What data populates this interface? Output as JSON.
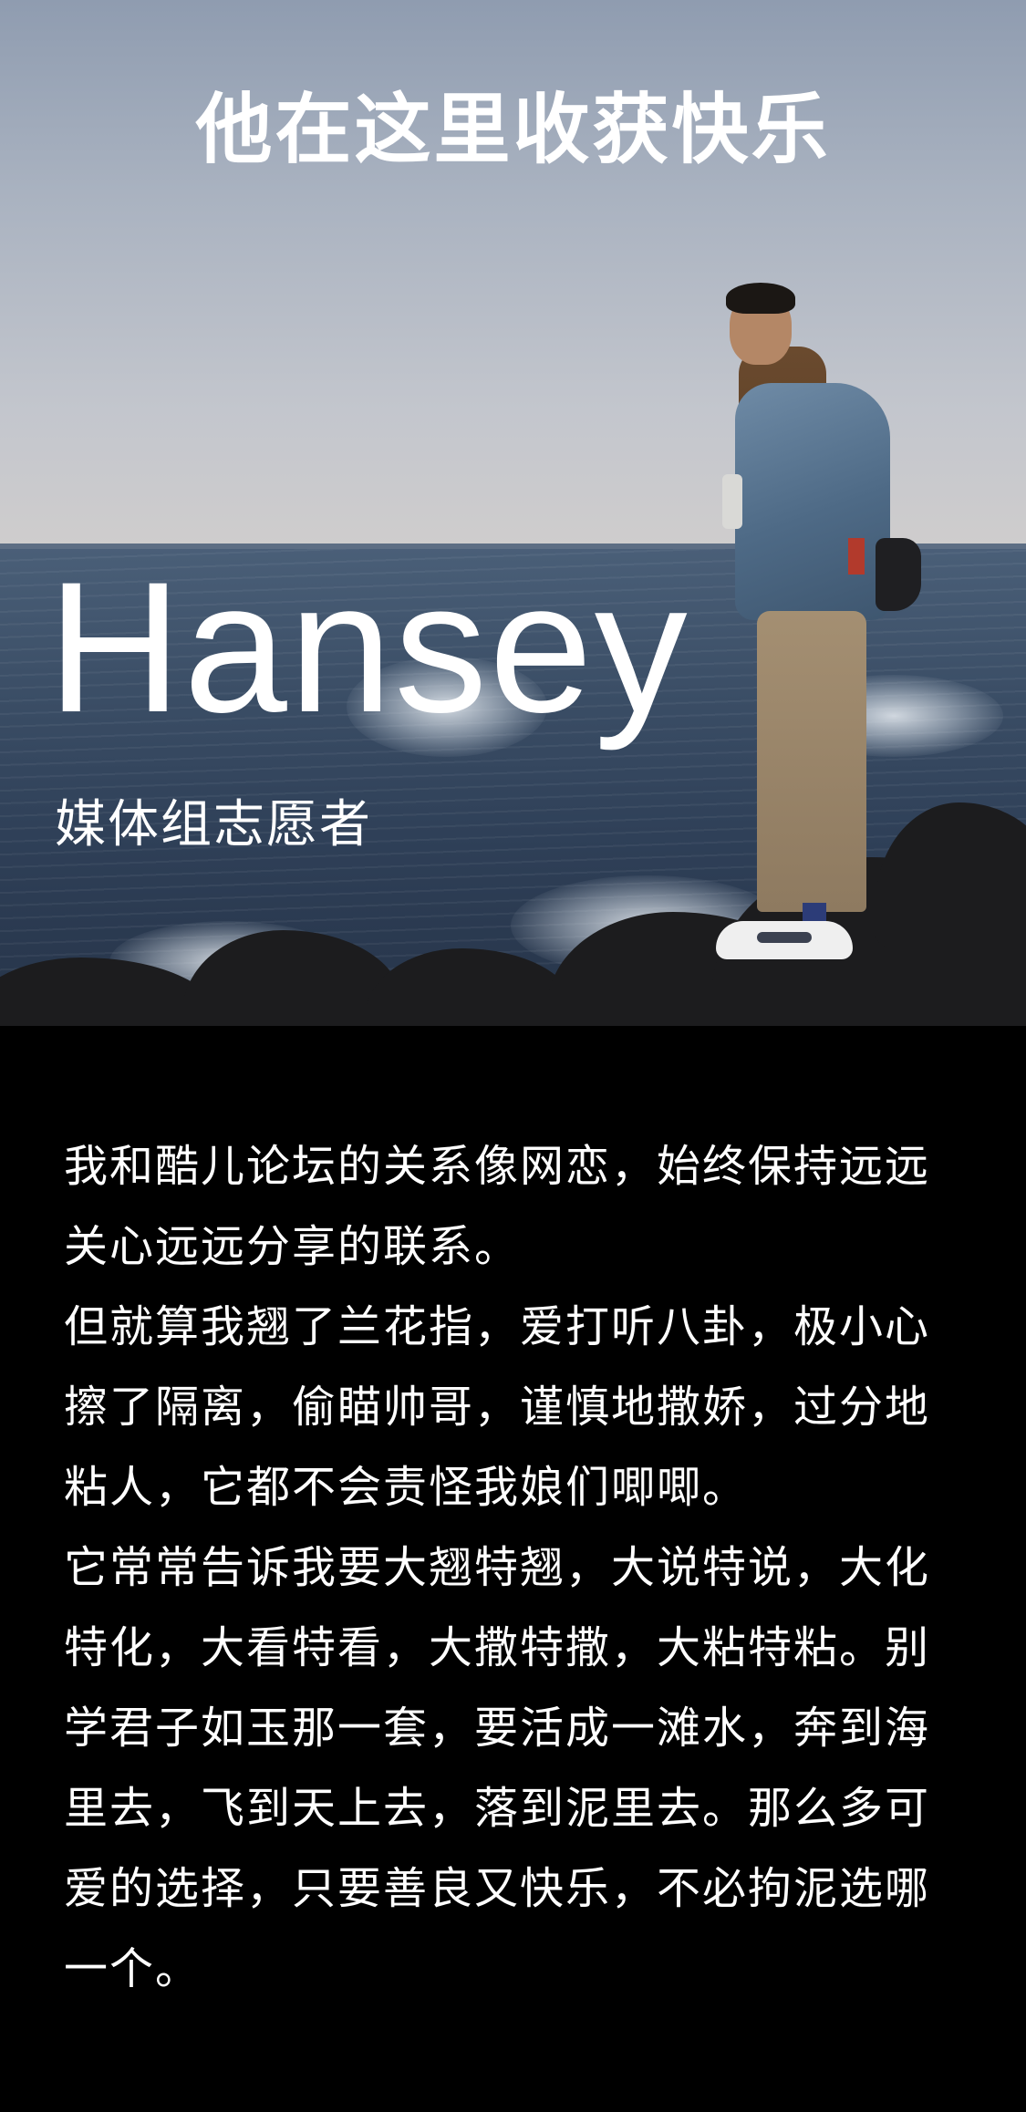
{
  "hero": {
    "headline": "他在这里收获快乐",
    "name": "Hansey",
    "role": "媒体组志愿者"
  },
  "body": {
    "paragraphs": [
      "我和酷儿论坛的关系像网恋，始终保持远远关心远远分享的联系。",
      "但就算我翘了兰花指，爱打听八卦，极小心擦了隔离，偷瞄帅哥，谨慎地撒娇，过分地粘人，它都不会责怪我娘们唧唧。",
      "它常常告诉我要大翘特翘，大说特说，大化特化，大看特看，大撒特撒，大粘特粘。别学君子如玉那一套，要活成一滩水，奔到海里去，飞到天上去，落到泥里去。那么多可爱的选择，只要善良又快乐，不必拘泥选哪一个。"
    ]
  },
  "colors": {
    "background": "#000000",
    "text": "#ffffff",
    "sky": "#a9b2c0",
    "sea": "#3b4e66"
  }
}
